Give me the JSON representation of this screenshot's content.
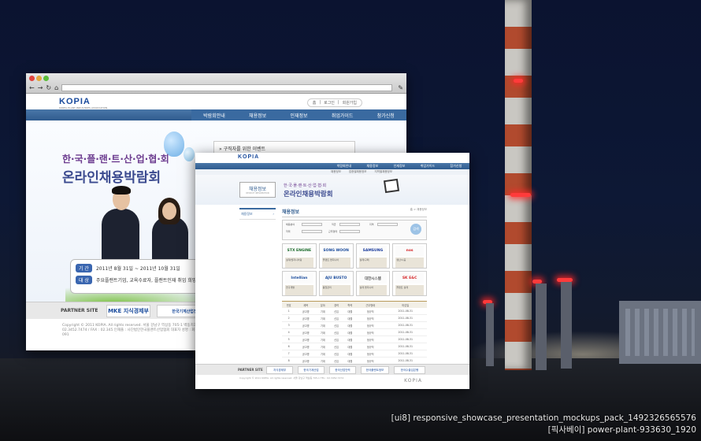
{
  "caption": {
    "line1": "[ui8] responsive_showcase_presentation_mockups_pack_1492326565576",
    "line2": "[픽사베이] power-plant-933630_1920"
  },
  "window1": {
    "logo": "KOPIA",
    "logo_sub": "KOREA PLANT INDUSTRIES ASSOCIATION",
    "utility": [
      "홈",
      "로그인",
      "회원가입"
    ],
    "menu": [
      "박람회안내",
      "채용정보",
      "인재정보",
      "취업가이드",
      "참가신청"
    ],
    "hero_line1": "한·국·플·랜·트·산·업·협·회",
    "hero_line2": "온라인채용박람회",
    "event_box": "구직자를 위한 이벤트",
    "info_tag1": "기 간",
    "info_text1": "2011년 8월 31일 ~ 2011년 10월 31일",
    "info_tag2": "대 상",
    "info_text2": "주요플랜트기업, 교육수료자, 플랜트인재 취업 희망자",
    "partner_label": "PARTNER SITE",
    "partners": [
      "MKE 지식경제부",
      "한국기계산업진흥회"
    ],
    "footer": "Copyright © 2011 KOPIA. All rights reserved. 서울 강남구 역삼동 705-1 벽동치과빌딩 1002호 TEL : 02.3452.7474 / FAX : 02.345 인재풀 : 사단법인한국플랜트산업협회 대표자 성명 : 회장단 고유번호 : 107-82-091"
  },
  "window2": {
    "logo": "KOPIA",
    "menu": [
      "박람회안내",
      "채용정보",
      "인재정보",
      "취업가이드",
      "참가신청"
    ],
    "submenu": [
      "채용정보",
      "업종별채용정보",
      "지역별채용정보"
    ],
    "box_title": "채용정보",
    "box_sub": "RECRUIT INFORMATION",
    "hero_line1": "한·국·플·랜·트·산·업·협·회",
    "hero_line2": "온라인채용박람회",
    "side_item": "채용정보",
    "section_title": "채용정보",
    "breadcrumb": "홈 > 채용정보",
    "search_labels": [
      "채용분야",
      "직급",
      "지역",
      "학력",
      "근무형태"
    ],
    "search_button": "검색",
    "companies": [
      {
        "name": "STX ENGINE",
        "color": "#1a6b2a",
        "desc": "설계/엔지니어링"
      },
      {
        "name": "SONG WOON",
        "color": "#1a4b9c",
        "desc": "플랜트 엔지니어"
      },
      {
        "name": "SAMSUNG",
        "color": "#1a3b9c",
        "desc": "설계/구매"
      },
      {
        "name": "nos",
        "color": "#d6282a",
        "desc": "생산/시공"
      },
      {
        "name": "Intellian",
        "color": "#1a4b9c",
        "desc": "연구개발"
      },
      {
        "name": "AJU BUSTO",
        "color": "#1a4b9c",
        "desc": "품질관리"
      },
      {
        "name": "대한시스템",
        "color": "#555555",
        "desc": "설계 엔지니어"
      },
      {
        "name": "SK E&C",
        "color": "#d6282a",
        "desc": "플랜트 설계"
      }
    ],
    "table_headers": [
      "번호",
      "제목",
      "분야",
      "경력",
      "학력",
      "근무형태",
      "마감일"
    ],
    "table_rows": [
      [
        "1",
        "공고명",
        "기계",
        "신입",
        "대졸",
        "정규직",
        "2011-08-31"
      ],
      [
        "2",
        "공고명",
        "기계",
        "신입",
        "대졸",
        "정규직",
        "2011-08-31"
      ],
      [
        "3",
        "공고명",
        "기계",
        "신입",
        "대졸",
        "정규직",
        "2011-08-31"
      ],
      [
        "4",
        "공고명",
        "기계",
        "신입",
        "대졸",
        "정규직",
        "2011-08-31"
      ],
      [
        "5",
        "공고명",
        "기계",
        "신입",
        "대졸",
        "정규직",
        "2011-08-31"
      ],
      [
        "6",
        "공고명",
        "기계",
        "신입",
        "대졸",
        "정규직",
        "2011-08-31"
      ],
      [
        "7",
        "공고명",
        "기계",
        "신입",
        "대졸",
        "정규직",
        "2011-08-31"
      ],
      [
        "8",
        "공고명",
        "기계",
        "신입",
        "대졸",
        "정규직",
        "2011-08-31"
      ],
      [
        "9",
        "공고명",
        "기계",
        "신입",
        "대졸",
        "정규직",
        "2011-08-31"
      ]
    ],
    "partner_label": "PARTNER SITE",
    "partners": [
      "지식경제부",
      "한국기계산업",
      "한국산업인력",
      "한국플랜트정보",
      "한국수출입은행"
    ],
    "footer": "Copyright © 2011 KOPIA. All rights reserved. 서울 강남구 역삼동 705-1 TEL : 02.3452.7474",
    "footer_logo": "KOPIA"
  },
  "colors": {
    "accent": "#2f5b8e",
    "brand": "#1a4b9c",
    "title_purple": "#6c3b8f"
  }
}
